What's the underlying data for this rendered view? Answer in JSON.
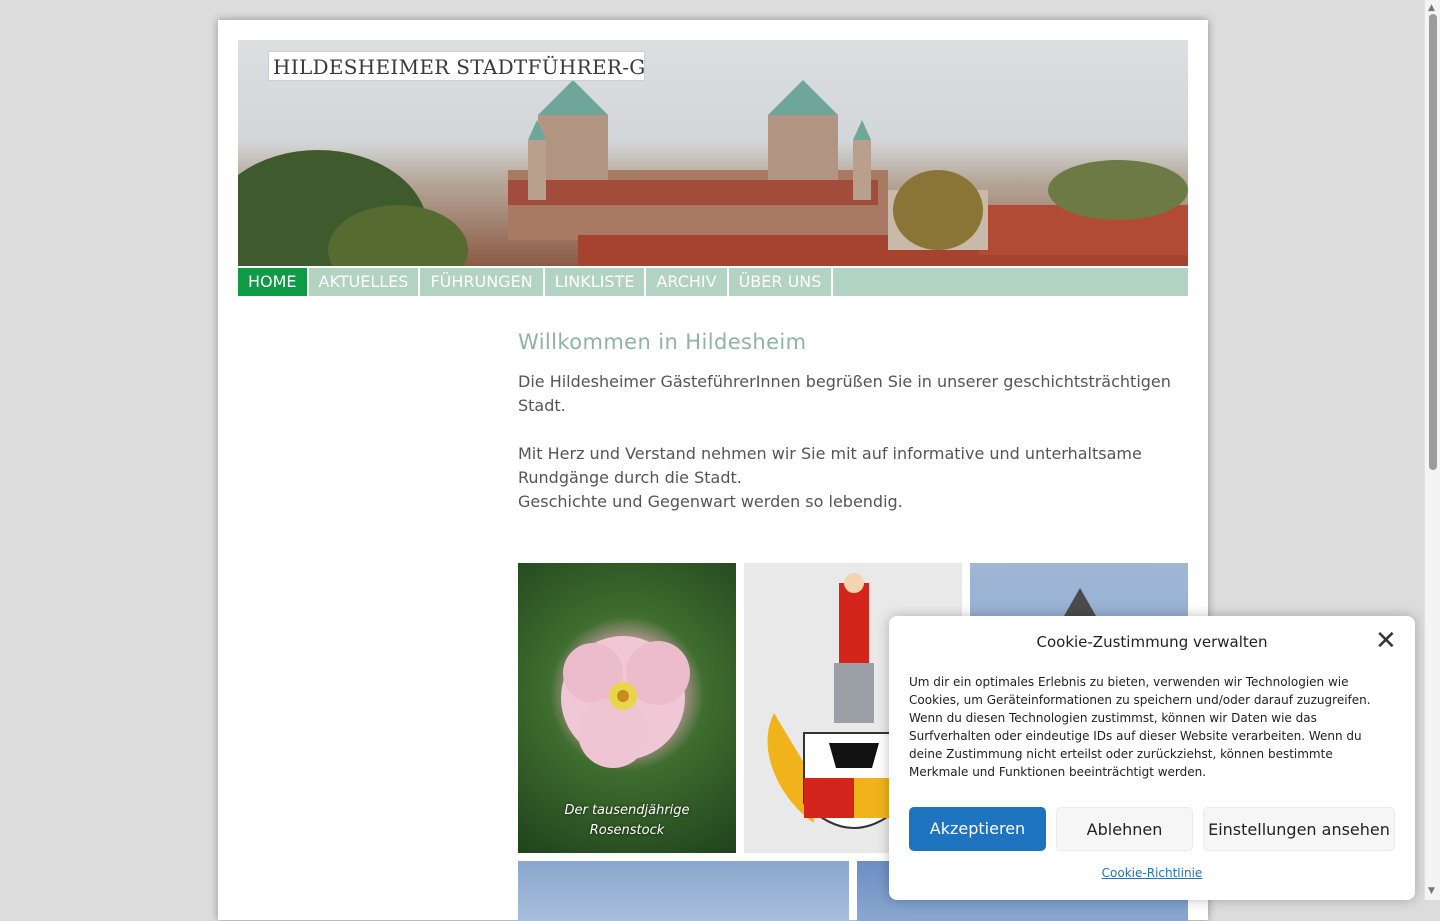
{
  "header": {
    "logo_text": "HILDESHEIMER STADTFÜHRER-GILDE E.V."
  },
  "nav": {
    "items": [
      {
        "label": "HOME"
      },
      {
        "label": "AKTUELLES"
      },
      {
        "label": "FÜHRUNGEN"
      },
      {
        "label": "LINKLISTE"
      },
      {
        "label": "ARCHIV"
      },
      {
        "label": "ÜBER UNS"
      }
    ],
    "active_index": 0
  },
  "main": {
    "title": "Willkommen in Hildesheim",
    "paragraph1": "Die Hildesheimer GästeführerInnen begrüßen Sie in unserer geschichtsträchtigen Stadt.",
    "paragraph2_line1": "Mit Herz und Verstand nehmen wir Sie mit auf informative und unterhaltsame Rundgänge durch die Stadt.",
    "paragraph2_line2": "Geschichte und Gegenwart werden so lebendig."
  },
  "gallery": {
    "items": [
      {
        "caption": "Der tausendjährige Rosenstock"
      }
    ]
  },
  "cookie": {
    "title": "Cookie-Zustimmung verwalten",
    "text": "Um dir ein optimales Erlebnis zu bieten, verwenden wir Technologien wie Cookies, um Geräteinformationen zu speichern und/oder darauf zuzugreifen. Wenn du diesen Technologien zustimmst, können wir Daten wie das Surfverhalten oder eindeutige IDs auf dieser Website verarbeiten. Wenn du deine Zustimmung nicht erteilst oder zurückziehst, können bestimmte Merkmale und Funktionen beeinträchtigt werden.",
    "accept_label": "Akzeptieren",
    "deny_label": "Ablehnen",
    "prefs_label": "Einstellungen ansehen",
    "policy_link": "Cookie-Richtlinie",
    "close_symbol": "✕"
  },
  "colors": {
    "nav_bg": "#b3d3c2",
    "nav_active": "#0f9a45",
    "title_color": "#8fb4a2",
    "accept_button": "#1e73be"
  }
}
